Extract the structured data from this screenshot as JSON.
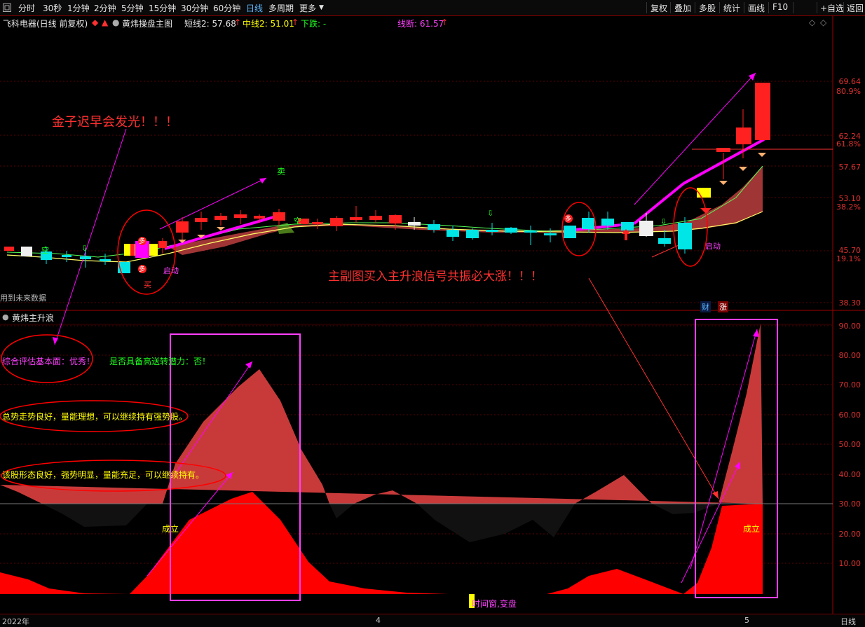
{
  "toolbar": {
    "left": [
      "分时",
      "30秒",
      "1分钟",
      "2分钟",
      "5分钟",
      "15分钟",
      "30分钟",
      "60分钟",
      "日线",
      "多周期",
      "更多"
    ],
    "active_index": 8,
    "right": [
      "复权",
      "叠加",
      "多股",
      "统计",
      "画线",
      "F10",
      "+自选",
      "返回"
    ]
  },
  "header": {
    "stock": "飞科电器(日线 前复权)",
    "indicator": "黄炜操盘主图",
    "short_line": "短线2: 57.68",
    "short_arrow": "↑",
    "mid_line": "中线2: 51.01",
    "mid_arrow": "↑",
    "down": "下跌: -",
    "line_break": "线断: 61.57",
    "line_break_arrow": "↑"
  },
  "main_axis": {
    "ticks": [
      "69.64",
      "80.9%",
      "62.24",
      "61.8%",
      "57.67",
      "53.10",
      "38.2%",
      "45.70",
      "19.1%",
      "38.30"
    ]
  },
  "main_labels": {
    "kong1": "空",
    "kong2": "空",
    "sell": "卖",
    "buy": "买",
    "duo1": "多",
    "duo2": "多",
    "duo3": "多",
    "qidong1": "启动",
    "qidong2": "启动",
    "future": "用到未来数据",
    "cai": "财",
    "zhang": "涨"
  },
  "annotations": {
    "gold": "金子迟早会发光！！！",
    "resonate": "主副图买入主升浪信号共振必大涨！！！"
  },
  "sub": {
    "title": "黄炜主升浪",
    "eval": "综合评估基本面：优秀！",
    "transfer": "是否具备高送转潜力：否！",
    "trend": "总势走势良好，量能理想，可以继续持有强势股。",
    "shape": "该股形态良好，强势明显，量能充足，可以继续持有。",
    "cheng1": "成立",
    "cheng2": "成立",
    "window": "时间窗,变盘",
    "axis": [
      "90.00",
      "80.00",
      "70.00",
      "60.00",
      "50.00",
      "40.00",
      "30.00",
      "20.00",
      "10.00"
    ]
  },
  "status": {
    "year": "2022年",
    "m4": "4",
    "m5": "5",
    "period": "日线"
  },
  "colors": {
    "up": "#ff2020",
    "down": "#00e5e5",
    "magenta": "#ff00ff",
    "fill": "#c83a3a"
  }
}
